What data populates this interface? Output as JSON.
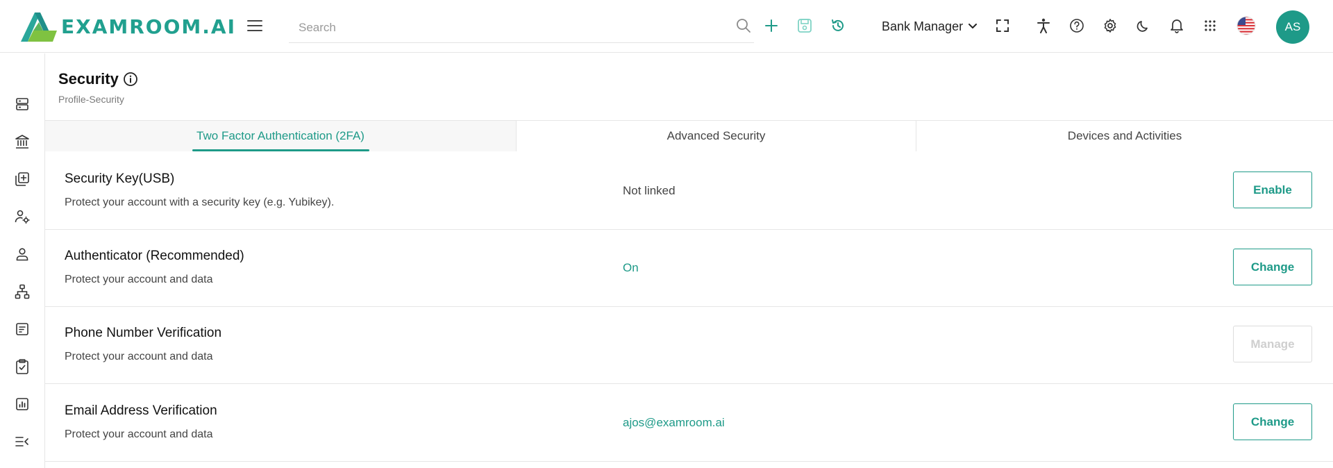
{
  "header": {
    "logo_text": "EXAMROOM.AI",
    "search_placeholder": "Search",
    "role": "Bank Manager",
    "avatar_initials": "AS",
    "accent_color": "#1e9a88"
  },
  "sidebar": {
    "items": [
      {
        "icon": "server-icon"
      },
      {
        "icon": "bank-icon"
      },
      {
        "icon": "add-library-icon"
      },
      {
        "icon": "user-settings-icon"
      },
      {
        "icon": "user-icon"
      },
      {
        "icon": "hierarchy-icon"
      },
      {
        "icon": "document-list-icon"
      },
      {
        "icon": "clipboard-check-icon"
      },
      {
        "icon": "bar-chart-icon"
      },
      {
        "icon": "collapse-menu-icon"
      }
    ]
  },
  "page": {
    "title": "Security",
    "breadcrumb": "Profile-Security"
  },
  "tabs": [
    {
      "label": "Two Factor Authentication (2FA)",
      "active": true
    },
    {
      "label": "Advanced Security",
      "active": false
    },
    {
      "label": "Devices and Activities",
      "active": false
    }
  ],
  "rows": [
    {
      "title": "Security Key(USB)",
      "description": "Protect your account with a security key (e.g. Yubikey).",
      "status": "Not linked",
      "button": "Enable",
      "enabled": true
    },
    {
      "title": "Authenticator (Recommended)",
      "description": "Protect your account and data",
      "status": "On",
      "button": "Change",
      "enabled": true
    },
    {
      "title": "Phone Number Verification",
      "description": "Protect your account and data",
      "status": "",
      "button": "Manage",
      "enabled": false
    },
    {
      "title": "Email Address Verification",
      "description": "Protect your account and data",
      "status": "ajos@examroom.ai",
      "button": "Change",
      "enabled": true
    }
  ]
}
